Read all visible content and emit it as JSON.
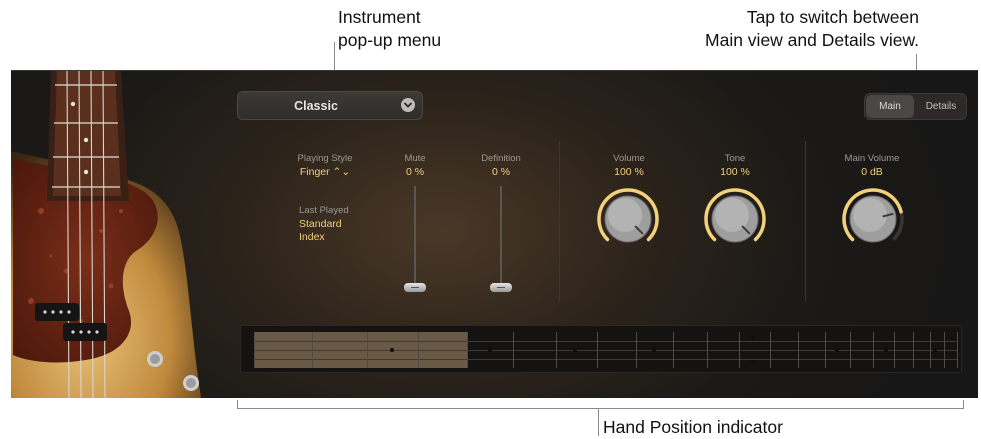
{
  "callouts": {
    "instrument_line1": "Instrument",
    "instrument_line2": "pop-up menu",
    "tap_line1": "Tap to switch between",
    "tap_line2": "Main view and Details view.",
    "hand_position": "Hand Position indicator"
  },
  "instrument_popup": {
    "selected": "Classic"
  },
  "view_toggle": {
    "main": "Main",
    "details": "Details",
    "active": "Main"
  },
  "playing_style": {
    "label": "Playing Style",
    "value": "Finger ⌃⌄"
  },
  "last_played": {
    "label": "Last Played",
    "line1": "Standard",
    "line2": "Index"
  },
  "mute": {
    "label": "Mute",
    "value": "0 %",
    "level": 0
  },
  "definition": {
    "label": "Definition",
    "value": "0 %",
    "level": 0
  },
  "volume": {
    "label": "Volume",
    "value": "100 %",
    "level": 1.0
  },
  "tone": {
    "label": "Tone",
    "value": "100 %",
    "level": 1.0
  },
  "main_volume": {
    "label": "Main Volume",
    "value": "0 dB",
    "level": 0.78
  },
  "colors": {
    "accent": "#f0cf7a",
    "knob_ring": "#f2d07c",
    "panel": "#1c1a17"
  },
  "icons": {
    "popup": "chevron-down-icon",
    "bass": "bass-guitar-image"
  }
}
